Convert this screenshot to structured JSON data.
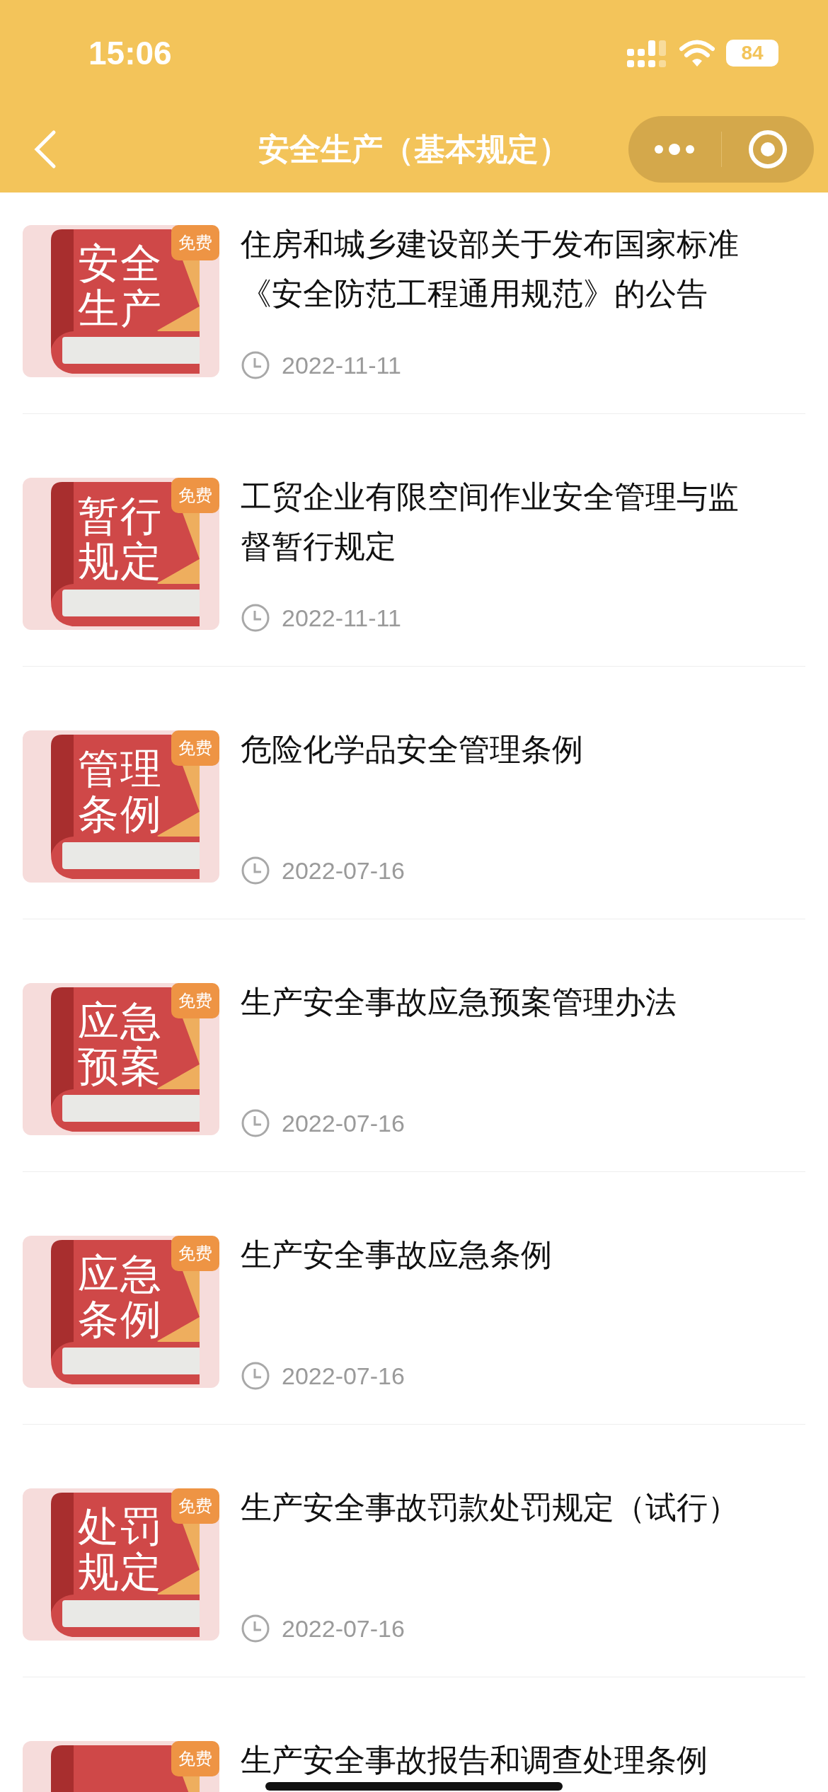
{
  "status_bar": {
    "time": "15:06",
    "battery": "84"
  },
  "nav": {
    "title": "安全生产（基本规定）"
  },
  "items": [
    {
      "cover_lines": [
        "安全",
        "生产"
      ],
      "badge": "免费",
      "title": "住房和城乡建设部关于发布国家标准《安全防范工程通用规范》的公告",
      "date": "2022-11-11"
    },
    {
      "cover_lines": [
        "暂行",
        "规定"
      ],
      "badge": "免费",
      "title": "工贸企业有限空间作业安全管理与监督暂行规定",
      "date": "2022-11-11"
    },
    {
      "cover_lines": [
        "管理",
        "条例"
      ],
      "badge": "免费",
      "title": "危险化学品安全管理条例",
      "date": "2022-07-16"
    },
    {
      "cover_lines": [
        "应急",
        "预案"
      ],
      "badge": "免费",
      "title": "生产安全事故应急预案管理办法",
      "date": "2022-07-16"
    },
    {
      "cover_lines": [
        "应急",
        "条例"
      ],
      "badge": "免费",
      "title": "生产安全事故应急条例",
      "date": "2022-07-16"
    },
    {
      "cover_lines": [
        "处罚",
        "规定"
      ],
      "badge": "免费",
      "title": "生产安全事故罚款处罚规定（试行）",
      "date": "2022-07-16"
    },
    {
      "badge": "免费",
      "title": "生产安全事故报告和调查处理条例"
    }
  ]
}
